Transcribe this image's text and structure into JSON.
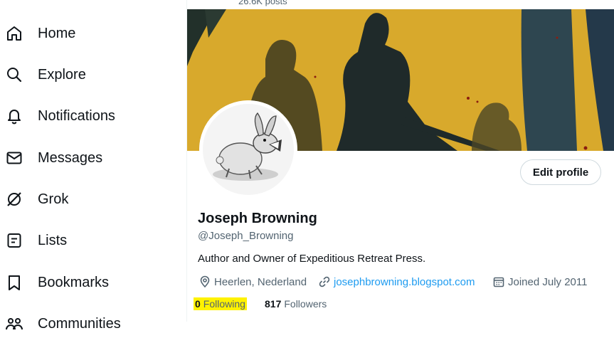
{
  "sidebar": {
    "items": [
      {
        "label": "Home",
        "icon": "home-icon"
      },
      {
        "label": "Explore",
        "icon": "search-icon"
      },
      {
        "label": "Notifications",
        "icon": "bell-icon"
      },
      {
        "label": "Messages",
        "icon": "envelope-icon"
      },
      {
        "label": "Grok",
        "icon": "grok-icon"
      },
      {
        "label": "Lists",
        "icon": "list-icon"
      },
      {
        "label": "Bookmarks",
        "icon": "bookmark-icon"
      },
      {
        "label": "Communities",
        "icon": "communities-icon"
      }
    ]
  },
  "header": {
    "posts_count": "26.6K posts"
  },
  "profile": {
    "name": "Joseph Browning",
    "handle": "@Joseph_Browning",
    "bio": "Author and Owner of Expeditious Retreat Press.",
    "location": "Heerlen, Nederland",
    "website": "josephbrowning.blogspot.com",
    "joined": "Joined July 2011",
    "following_count": "0",
    "following_label": "Following",
    "followers_count": "817",
    "followers_label": "Followers",
    "edit_button": "Edit profile"
  },
  "colors": {
    "accent": "#1d9bf0",
    "highlight": "#fff200",
    "banner": "#d8a92c"
  }
}
